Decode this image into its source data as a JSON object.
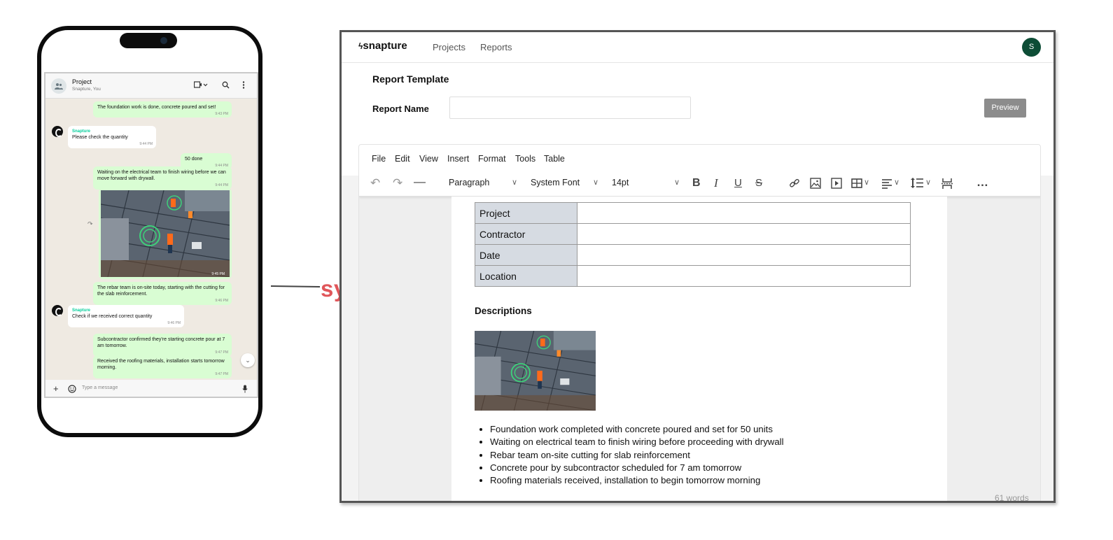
{
  "chat": {
    "title": "Project",
    "subtitle": "Snapture, You",
    "messages": [
      {
        "text": "The foundation work is done, concrete poured and set!",
        "time": "9:43 PM"
      },
      {
        "sender": "Snapture",
        "text": "Please check the quantity",
        "time": "9:44 PM"
      },
      {
        "text": "50 done",
        "time": "9:44 PM"
      },
      {
        "text": "Waiting on the electrical team to finish wiring before we can move forward with drywall.",
        "time": "9:44 PM"
      },
      {
        "time": "9:45 PM"
      },
      {
        "text": "The rebar team is on-site today, starting with the cutting for the slab reinforcement.",
        "time": "9:46 PM"
      },
      {
        "sender": "Snapture",
        "text": "Check if we received correct quantity",
        "time": "9:46 PM"
      },
      {
        "text": "Subcontractor confirmed they're starting concrete pour at 7 am tomorrow.",
        "time": "9:47 PM"
      },
      {
        "text": "Received the roofing materials, installation starts tomorrow morning.",
        "time": "9:47 PM"
      }
    ],
    "input_placeholder": "Type a message"
  },
  "sync_label": "sync",
  "app": {
    "logo": "snapture",
    "nav": [
      "Projects",
      "Reports"
    ],
    "user_initial": "S"
  },
  "report": {
    "section_title": "Report Template",
    "name_label": "Report Name",
    "name_value": "",
    "preview_label": "Preview"
  },
  "editor": {
    "menus": [
      "File",
      "Edit",
      "View",
      "Insert",
      "Format",
      "Tools",
      "Table"
    ],
    "block_format": "Paragraph",
    "font_family": "System Font",
    "font_size": "14pt",
    "word_count": "61 words"
  },
  "document": {
    "table_rows": [
      {
        "label": "Project",
        "value": ""
      },
      {
        "label": "Contractor",
        "value": ""
      },
      {
        "label": "Date",
        "value": ""
      },
      {
        "label": "Location",
        "value": ""
      }
    ],
    "descriptions_heading": "Descriptions",
    "bullets": [
      "Foundation work completed with concrete poured and set for 50 units",
      "Waiting on electrical team to finish wiring before proceeding with drywall",
      "Rebar team on-site cutting for slab reinforcement",
      "Concrete pour by subcontractor scheduled for 7 am tomorrow",
      "Roofing materials received, installation to begin tomorrow morning"
    ]
  },
  "colors": {
    "sync": "#e0565a",
    "chat_bubble_out": "#d9fdd3",
    "chat_bg": "#efeae2",
    "avatar": "#0d4d36",
    "table_header": "#d6dbe2"
  }
}
